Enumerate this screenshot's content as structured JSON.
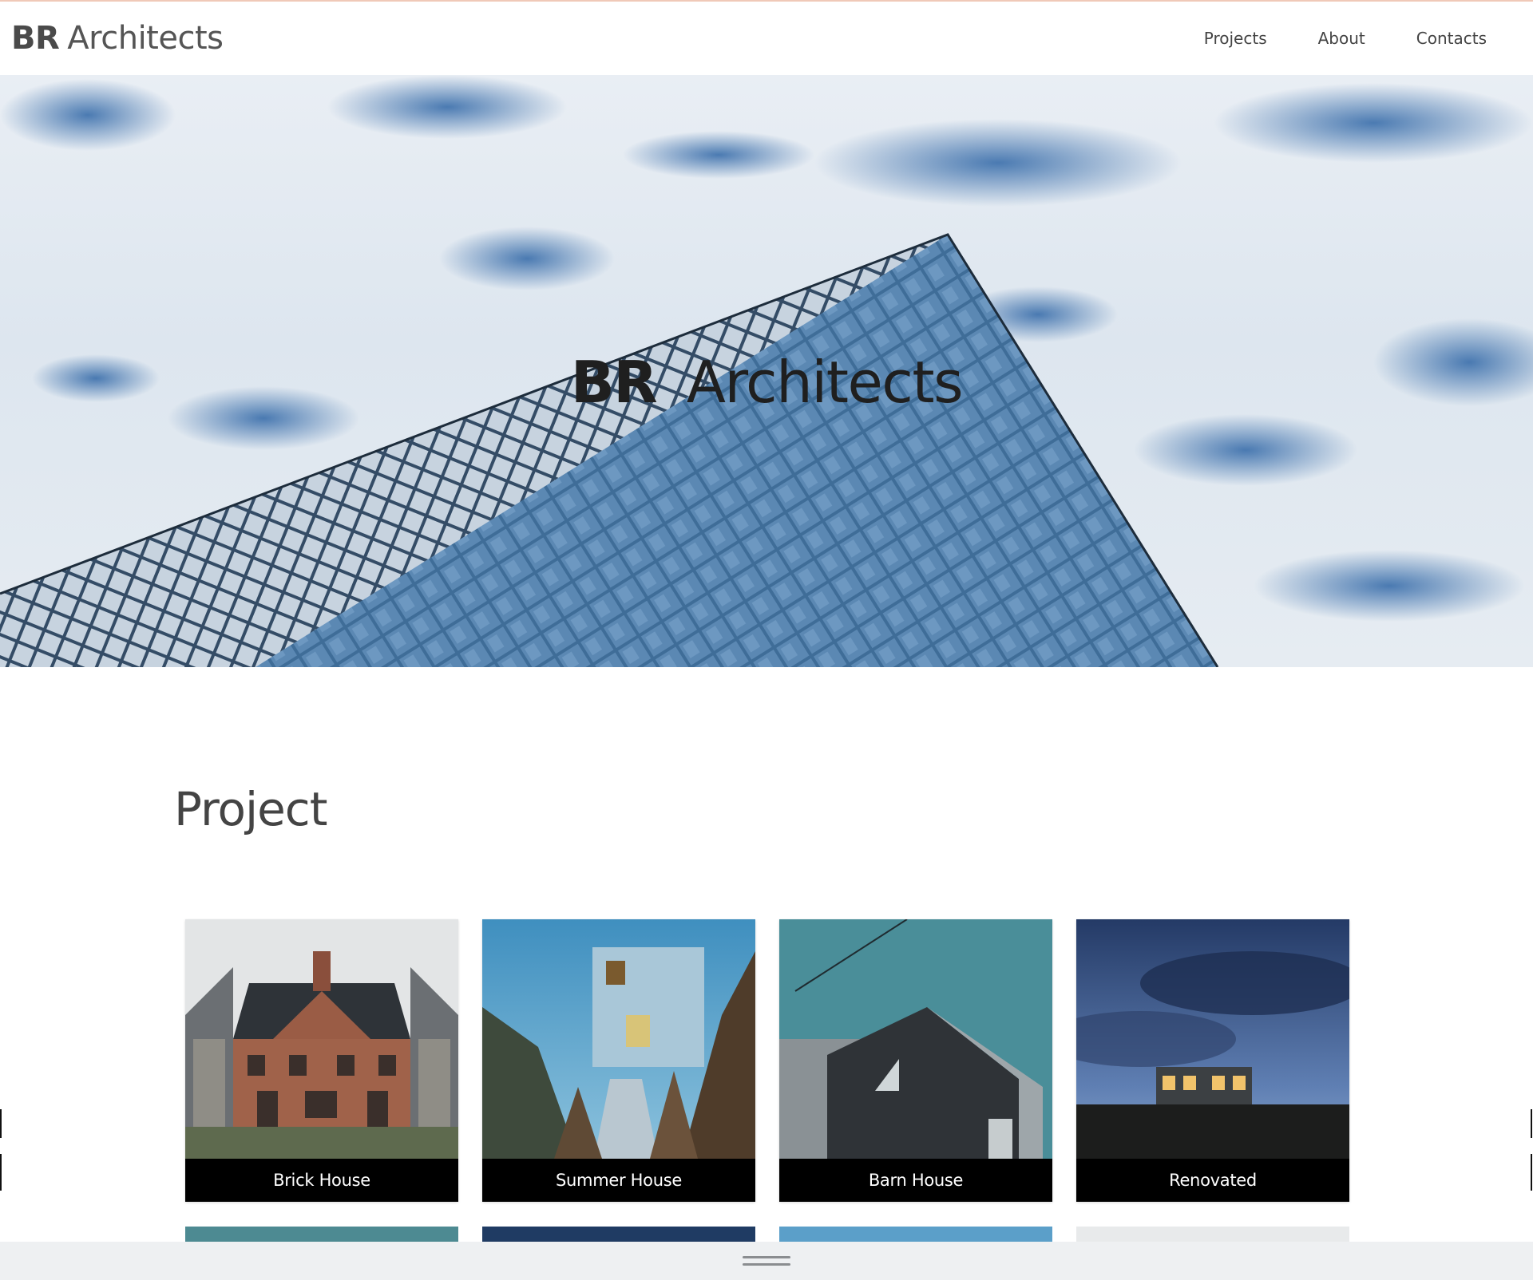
{
  "navbar": {
    "brand_bold": "BR",
    "brand_rest": "Architects",
    "links": [
      "Projects",
      "About",
      "Contacts"
    ]
  },
  "hero": {
    "title_bold": "BR",
    "title_rest": "Architects"
  },
  "projects": {
    "heading": "Project",
    "cards": [
      {
        "label": "Brick House"
      },
      {
        "label": "Summer House"
      },
      {
        "label": "Barn House"
      },
      {
        "label": "Renovated"
      }
    ]
  },
  "colors": {
    "caption_bg": "#000000",
    "caption_text": "#ffffff",
    "bottom_bar": "#eef0f2",
    "top_accent": "#f0c9b8"
  },
  "icons": {
    "drawer_handle": "drag-handle-icon"
  }
}
